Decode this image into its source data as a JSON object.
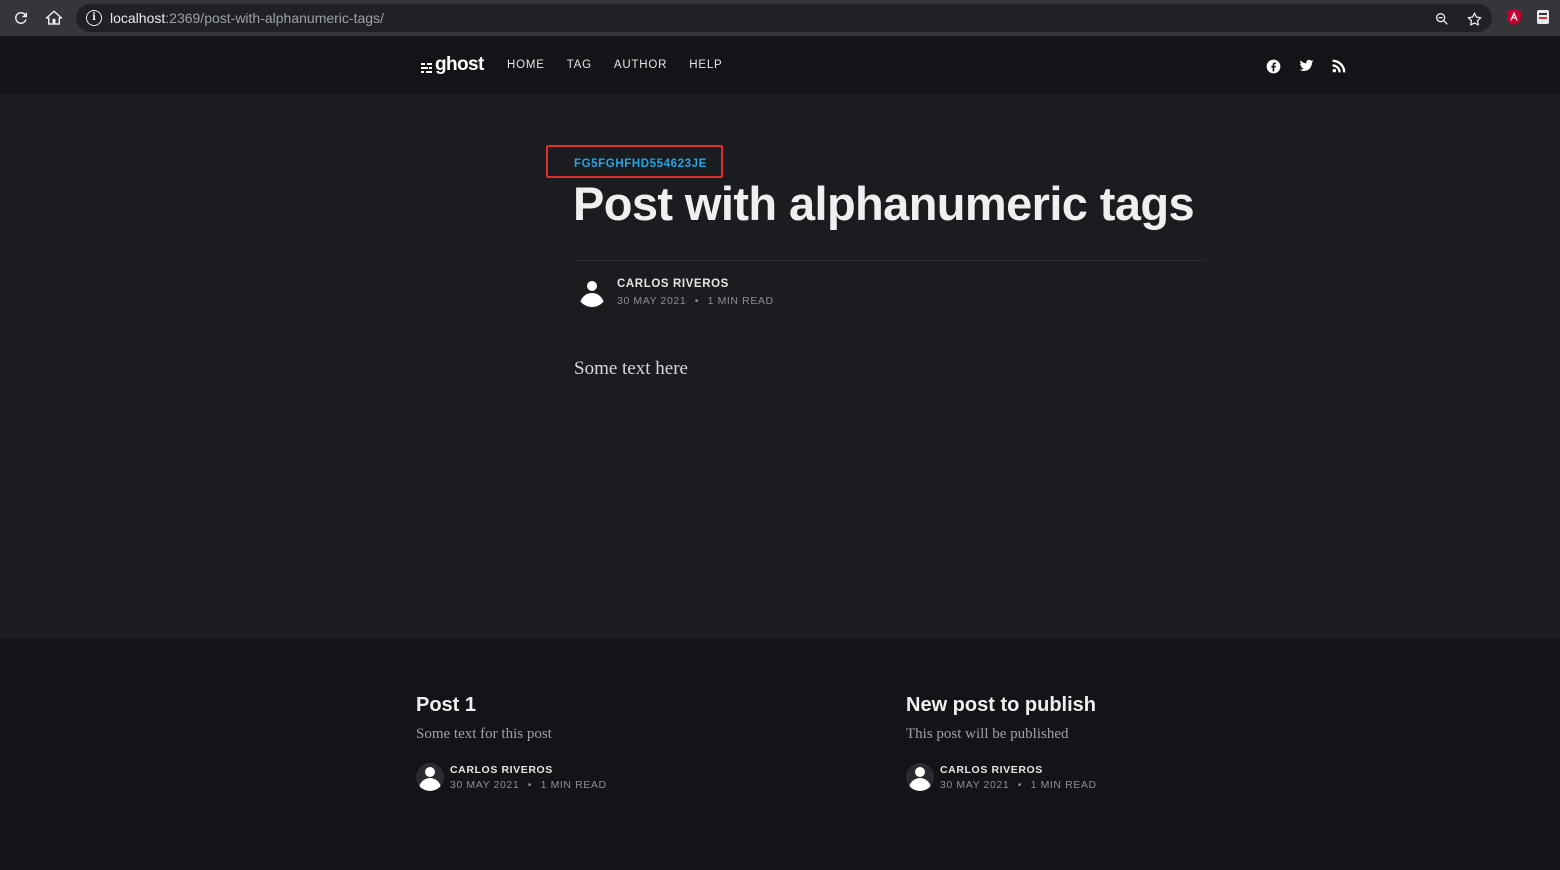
{
  "browser": {
    "url_host": "localhost",
    "url_path": ":2369/post-with-alphanumeric-tags/",
    "icons": [
      "reload-icon",
      "home-icon",
      "info-icon",
      "zoom-icon",
      "bookmark-star-icon",
      "angular-extension-icon",
      "extension-icon"
    ]
  },
  "site": {
    "logo_text": "ghost",
    "nav": [
      {
        "label": "HOME"
      },
      {
        "label": "TAG"
      },
      {
        "label": "AUTHOR"
      },
      {
        "label": "HELP"
      }
    ],
    "social_icons": [
      "facebook-icon",
      "twitter-icon",
      "rss-icon"
    ]
  },
  "article": {
    "tag": "FG5FGHFHD554623JE",
    "title": "Post with alphanumeric tags",
    "author": "CARLOS RIVEROS",
    "date": "30 MAY 2021",
    "separator": "•",
    "read_time": "1 MIN READ",
    "body": "Some text here",
    "highlight_color": "#e02d2d",
    "tag_color": "#29a4df"
  },
  "related": [
    {
      "title": "Post 1",
      "excerpt": "Some text for this post",
      "author": "CARLOS RIVEROS",
      "date": "30 MAY 2021",
      "separator": "•",
      "read_time": "1 MIN READ"
    },
    {
      "title": "New post to publish",
      "excerpt": "This post will be published",
      "author": "CARLOS RIVEROS",
      "date": "30 MAY 2021",
      "separator": "•",
      "read_time": "1 MIN READ"
    }
  ]
}
